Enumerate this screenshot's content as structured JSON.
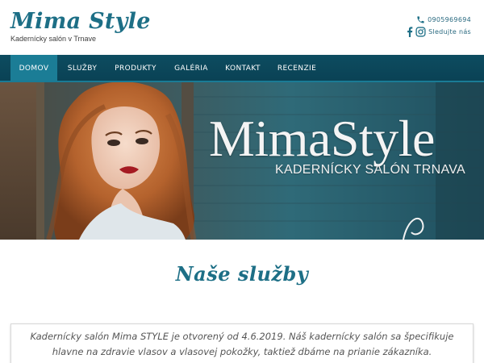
{
  "header": {
    "logo": "Mima Style",
    "tagline": "Kadernícky salón v Trnave",
    "phone": "0905969694",
    "phone_icon": "phone-icon",
    "facebook_icon": "facebook-icon",
    "instagram_icon": "instagram-icon",
    "follow_label": "Sledujte nás"
  },
  "nav": {
    "items": [
      {
        "label": "DOMOV",
        "active": true
      },
      {
        "label": "SLUŽBY"
      },
      {
        "label": "PRODUKTY"
      },
      {
        "label": "GALÉRIA"
      },
      {
        "label": "KONTAKT"
      },
      {
        "label": "RECENZIE"
      }
    ]
  },
  "hero": {
    "title": "MimaStyle",
    "subtitle": "KADERNÍCKY SALÓN TRNAVA"
  },
  "services": {
    "title": "Naše služby"
  },
  "intro": {
    "text": "Kadernícky salón Mima STYLE je otvorený od 4.6.2019. Náš kadernícky salón sa špecifikuje hlavne na zdravie vlasov a vlasovej pokožky, taktiež dbáme na prianie zákazníka."
  },
  "colors": {
    "brand": "#1d6f86",
    "nav_bg": "#0d4c60",
    "nav_active": "#1b7d96"
  }
}
